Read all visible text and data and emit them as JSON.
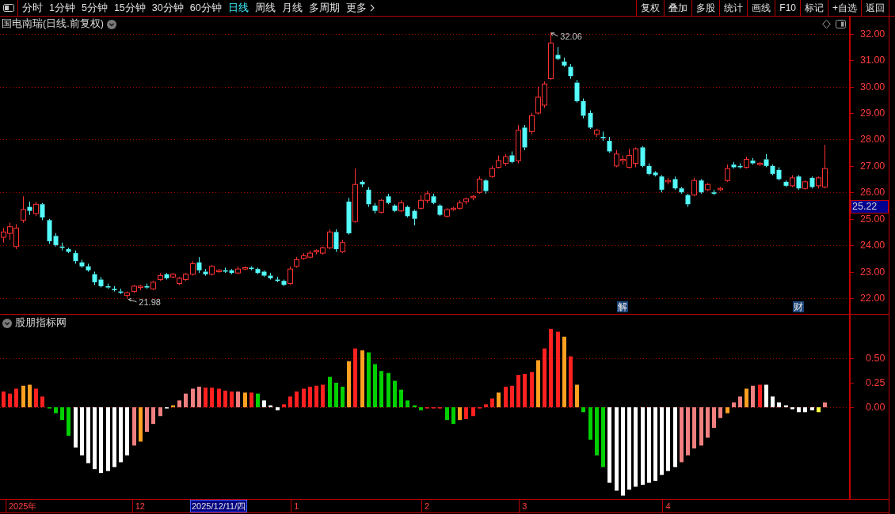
{
  "toolbar": {
    "periods": [
      {
        "label": "分时",
        "selected": false,
        "kind": "period"
      },
      {
        "label": "1分钟",
        "selected": false,
        "kind": "period"
      },
      {
        "label": "5分钟",
        "selected": false,
        "kind": "period"
      },
      {
        "label": "15分钟",
        "selected": false,
        "kind": "period"
      },
      {
        "label": "30分钟",
        "selected": false,
        "kind": "period"
      },
      {
        "label": "60分钟",
        "selected": false,
        "kind": "period"
      },
      {
        "label": "日线",
        "selected": true,
        "kind": "period"
      },
      {
        "label": "周线",
        "selected": false,
        "kind": "period"
      },
      {
        "label": "月线",
        "selected": false,
        "kind": "period"
      },
      {
        "label": "多周期",
        "selected": false,
        "kind": "period"
      },
      {
        "label": "更多",
        "selected": false,
        "kind": "menu"
      }
    ],
    "actions": [
      "复权",
      "叠加",
      "多股",
      "统计",
      "画线",
      "F10",
      "标记",
      "+自选",
      "返回"
    ]
  },
  "price_pane": {
    "title": "国电南瑞(日线.前复权)",
    "cursor_price": "25.22",
    "chart_data": [
      {
        "type": "candlestick",
        "ylim": [
          21.4,
          32.65
        ],
        "grid": true,
        "yticks": [
          {
            "value": 22,
            "label": "22.00"
          },
          {
            "value": 23,
            "label": "23.00"
          },
          {
            "value": 24,
            "label": "24.00"
          },
          {
            "value": 25,
            "label": "25.00"
          },
          {
            "value": 26,
            "label": "26.00"
          },
          {
            "value": 27,
            "label": "27.00"
          },
          {
            "value": 28,
            "label": "28.00"
          },
          {
            "value": 29,
            "label": "29.00"
          },
          {
            "value": 30,
            "label": "30.00"
          },
          {
            "value": 31,
            "label": "31.00"
          },
          {
            "value": 32,
            "label": "32.00"
          }
        ],
        "annotations": [
          "32.06",
          "21.98"
        ],
        "categories": [
          null,
          null,
          null,
          null,
          null,
          null,
          null,
          null,
          null,
          null,
          null,
          null,
          null,
          null,
          null,
          null,
          null,
          null,
          null,
          null,
          null,
          null,
          null,
          null,
          null,
          null,
          null,
          null,
          null,
          null,
          null,
          null,
          null,
          null,
          null,
          null,
          null,
          null,
          null,
          null,
          null,
          null,
          null,
          null,
          null,
          null,
          null,
          null,
          null,
          null,
          null,
          null,
          null,
          null,
          null,
          null,
          null,
          null,
          null,
          null,
          null,
          null,
          null,
          null,
          null,
          null,
          null,
          null,
          null,
          null,
          null,
          null,
          null,
          null,
          null,
          null,
          null,
          null,
          null,
          null,
          null,
          null,
          null,
          null,
          null,
          null,
          null,
          null,
          null,
          null,
          null,
          null,
          null,
          null,
          null,
          "解",
          null,
          null,
          null,
          null,
          null,
          null,
          null,
          null,
          null,
          null,
          null,
          null,
          null,
          null,
          null,
          null,
          null,
          null,
          null,
          null,
          null,
          null,
          null,
          null,
          null,
          null,
          "财",
          null,
          null,
          null,
          null
        ],
        "ohlc": [
          [
            24.3,
            24.65,
            24.1,
            24.5
          ],
          [
            24.45,
            24.85,
            24.2,
            24.7
          ],
          [
            23.95,
            24.8,
            23.85,
            24.65
          ],
          [
            24.95,
            25.85,
            24.85,
            25.35
          ],
          [
            25.45,
            25.65,
            25.15,
            25.3
          ],
          [
            25.2,
            25.65,
            25.1,
            25.55
          ],
          [
            25.55,
            25.6,
            24.95,
            25.05
          ],
          [
            24.95,
            25.0,
            24.05,
            24.15
          ],
          [
            24.35,
            24.45,
            23.95,
            24.0
          ],
          [
            23.95,
            24.1,
            23.8,
            23.9
          ],
          [
            23.85,
            23.9,
            23.7,
            23.75
          ],
          [
            23.7,
            23.8,
            23.3,
            23.4
          ],
          [
            23.35,
            23.45,
            23.15,
            23.2
          ],
          [
            23.2,
            23.3,
            23.0,
            23.05
          ],
          [
            22.9,
            23.0,
            22.5,
            22.6
          ],
          [
            22.7,
            22.8,
            22.4,
            22.45
          ],
          [
            22.45,
            22.55,
            22.35,
            22.4
          ],
          [
            22.35,
            22.45,
            22.25,
            22.3
          ],
          [
            22.25,
            22.35,
            22.15,
            22.2
          ],
          [
            22.1,
            22.25,
            21.98,
            22.2
          ],
          [
            22.25,
            22.5,
            22.2,
            22.45
          ],
          [
            22.4,
            22.5,
            22.3,
            22.45
          ],
          [
            22.45,
            22.55,
            22.35,
            22.4
          ],
          [
            22.35,
            22.65,
            22.3,
            22.6
          ],
          [
            22.7,
            22.95,
            22.65,
            22.85
          ],
          [
            22.9,
            22.95,
            22.7,
            22.75
          ],
          [
            22.8,
            22.95,
            22.75,
            22.9
          ],
          [
            22.55,
            22.8,
            22.5,
            22.75
          ],
          [
            22.7,
            22.95,
            22.65,
            22.9
          ],
          [
            22.9,
            23.4,
            22.85,
            23.3
          ],
          [
            23.35,
            23.55,
            22.95,
            23.05
          ],
          [
            23.0,
            23.1,
            22.85,
            22.9
          ],
          [
            22.9,
            23.25,
            22.85,
            23.2
          ],
          [
            23.0,
            23.1,
            22.95,
            23.05
          ],
          [
            23.05,
            23.15,
            22.95,
            23.0
          ],
          [
            23.05,
            23.1,
            22.9,
            22.95
          ],
          [
            22.95,
            23.2,
            22.9,
            23.1
          ],
          [
            23.1,
            23.2,
            23.05,
            23.15
          ],
          [
            23.15,
            23.2,
            23.05,
            23.1
          ],
          [
            23.1,
            23.15,
            22.9,
            22.95
          ],
          [
            23.0,
            23.05,
            22.8,
            22.85
          ],
          [
            22.85,
            22.95,
            22.7,
            22.75
          ],
          [
            22.7,
            22.8,
            22.6,
            22.65
          ],
          [
            22.65,
            22.7,
            22.45,
            22.5
          ],
          [
            22.55,
            23.2,
            22.5,
            23.1
          ],
          [
            23.2,
            23.55,
            23.15,
            23.45
          ],
          [
            23.5,
            23.7,
            23.45,
            23.6
          ],
          [
            23.55,
            23.8,
            23.5,
            23.7
          ],
          [
            23.75,
            23.85,
            23.65,
            23.8
          ],
          [
            23.7,
            23.95,
            23.65,
            23.9
          ],
          [
            23.9,
            24.6,
            23.85,
            24.5
          ],
          [
            24.5,
            24.6,
            23.75,
            23.85
          ],
          [
            23.75,
            24.2,
            23.7,
            24.1
          ],
          [
            25.65,
            25.8,
            24.4,
            24.45
          ],
          [
            24.9,
            26.9,
            24.85,
            26.3
          ],
          [
            26.4,
            26.45,
            26.2,
            26.3
          ],
          [
            26.1,
            26.2,
            25.45,
            25.55
          ],
          [
            25.5,
            25.6,
            25.2,
            25.3
          ],
          [
            25.25,
            25.75,
            25.2,
            25.7
          ],
          [
            25.85,
            25.95,
            25.55,
            25.6
          ],
          [
            25.5,
            25.55,
            25.25,
            25.3
          ],
          [
            25.3,
            25.7,
            25.25,
            25.6
          ],
          [
            25.45,
            25.5,
            25.05,
            25.1
          ],
          [
            25.3,
            25.35,
            24.75,
            25.0
          ],
          [
            25.4,
            25.9,
            25.35,
            25.7
          ],
          [
            25.7,
            26.05,
            25.6,
            25.95
          ],
          [
            25.85,
            25.95,
            25.55,
            25.6
          ],
          [
            25.5,
            25.55,
            25.1,
            25.15
          ],
          [
            25.1,
            25.4,
            25.05,
            25.35
          ],
          [
            25.35,
            25.45,
            25.3,
            25.4
          ],
          [
            25.4,
            25.7,
            25.35,
            25.6
          ],
          [
            25.65,
            25.8,
            25.55,
            25.75
          ],
          [
            25.8,
            25.9,
            25.7,
            25.85
          ],
          [
            26.0,
            26.6,
            25.95,
            26.5
          ],
          [
            26.45,
            26.5,
            25.95,
            26.05
          ],
          [
            26.6,
            27.0,
            26.55,
            26.9
          ],
          [
            26.95,
            27.4,
            26.9,
            27.2
          ],
          [
            27.1,
            27.45,
            27.0,
            27.35
          ],
          [
            27.4,
            27.55,
            27.1,
            27.15
          ],
          [
            27.2,
            28.55,
            27.1,
            28.35
          ],
          [
            28.45,
            28.55,
            27.6,
            27.7
          ],
          [
            28.3,
            29.0,
            28.2,
            28.9
          ],
          [
            29.0,
            30.0,
            28.95,
            29.6
          ],
          [
            29.3,
            30.2,
            29.2,
            30.1
          ],
          [
            30.3,
            32.06,
            30.25,
            31.65
          ],
          [
            31.2,
            31.5,
            31.0,
            31.05
          ],
          [
            30.95,
            31.1,
            30.75,
            30.8
          ],
          [
            30.75,
            30.85,
            30.3,
            30.4
          ],
          [
            30.15,
            30.25,
            29.4,
            29.45
          ],
          [
            29.45,
            29.55,
            28.8,
            28.9
          ],
          [
            29.0,
            29.1,
            28.4,
            28.45
          ],
          [
            28.2,
            28.4,
            28.1,
            28.35
          ],
          [
            28.1,
            28.3,
            27.95,
            28.05
          ],
          [
            27.95,
            28.1,
            27.5,
            27.55
          ],
          [
            27.0,
            27.6,
            26.95,
            27.45
          ],
          [
            27.2,
            27.4,
            27.05,
            27.25
          ],
          [
            26.95,
            27.65,
            26.9,
            27.4
          ],
          [
            27.1,
            27.7,
            26.95,
            27.65
          ],
          [
            27.7,
            27.75,
            26.95,
            27.0
          ],
          [
            27.0,
            27.1,
            26.65,
            26.7
          ],
          [
            26.75,
            26.8,
            26.6,
            26.65
          ],
          [
            26.6,
            26.65,
            26.0,
            26.1
          ],
          [
            26.4,
            26.55,
            26.3,
            26.45
          ],
          [
            26.5,
            26.6,
            26.1,
            26.15
          ],
          [
            26.15,
            26.2,
            25.95,
            26.0
          ],
          [
            25.9,
            25.95,
            25.45,
            25.55
          ],
          [
            25.9,
            26.55,
            25.85,
            26.45
          ],
          [
            26.45,
            26.5,
            25.95,
            26.0
          ],
          [
            26.1,
            26.35,
            26.05,
            26.3
          ],
          [
            26.0,
            26.1,
            25.9,
            25.95
          ],
          [
            26.1,
            26.2,
            26.05,
            26.15
          ],
          [
            26.45,
            27.05,
            26.4,
            26.9
          ],
          [
            27.05,
            27.15,
            26.9,
            26.95
          ],
          [
            27.0,
            27.1,
            26.9,
            26.95
          ],
          [
            26.95,
            27.35,
            26.9,
            27.25
          ],
          [
            27.2,
            27.3,
            27.05,
            27.1
          ],
          [
            27.05,
            27.15,
            27.0,
            27.1
          ],
          [
            27.25,
            27.45,
            26.95,
            27.0
          ],
          [
            27.0,
            27.05,
            26.65,
            26.7
          ],
          [
            26.85,
            26.95,
            26.45,
            26.5
          ],
          [
            26.4,
            26.45,
            26.2,
            26.25
          ],
          [
            26.25,
            26.65,
            26.2,
            26.55
          ],
          [
            26.6,
            26.65,
            26.1,
            26.15
          ],
          [
            26.15,
            26.45,
            26.1,
            26.4
          ],
          [
            26.55,
            26.6,
            26.15,
            26.2
          ],
          [
            26.25,
            26.6,
            26.15,
            26.55
          ],
          [
            26.2,
            27.8,
            26.15,
            26.9
          ]
        ]
      }
    ]
  },
  "indicator_pane": {
    "title": "股朋指标网",
    "cursor_date": "2025/12/11/四",
    "chart_data": [
      {
        "type": "bar",
        "ylim": [
          -0.935,
          0.944
        ],
        "grid": true,
        "yticks": [
          {
            "value": 0,
            "label": "0.00"
          },
          {
            "value": 0.25,
            "label": "0.25"
          },
          {
            "value": 0.5,
            "label": "0.50"
          }
        ],
        "categories": [
          null,
          null,
          null,
          "2025年",
          null,
          null,
          null,
          null,
          null,
          null,
          null,
          null,
          null,
          null,
          null,
          null,
          null,
          null,
          null,
          null,
          null,
          "12",
          null,
          null,
          null,
          null,
          null,
          null,
          null,
          null,
          null,
          null,
          null,
          null,
          null,
          null,
          null,
          null,
          null,
          null,
          null,
          null,
          null,
          null,
          null,
          "1",
          null,
          null,
          null,
          null,
          null,
          null,
          null,
          null,
          null,
          null,
          null,
          null,
          null,
          null,
          null,
          null,
          null,
          null,
          null,
          "2",
          null,
          null,
          null,
          null,
          null,
          null,
          null,
          null,
          null,
          null,
          null,
          null,
          null,
          null,
          "3",
          null,
          null,
          null,
          null,
          null,
          null,
          null,
          null,
          null,
          null,
          null,
          null,
          null,
          null,
          null,
          null,
          null,
          null,
          null,
          null,
          null,
          "4",
          null,
          null,
          null,
          null,
          null,
          null,
          null,
          null,
          null,
          null,
          null,
          null,
          null,
          null,
          null,
          null,
          null,
          null,
          null,
          null,
          null,
          null,
          null,
          null
        ],
        "values": [
          0.16,
          0.14,
          0.19,
          0.22,
          0.23,
          0.19,
          0.11,
          -0.01,
          -0.06,
          -0.13,
          -0.29,
          -0.41,
          -0.49,
          -0.57,
          -0.63,
          -0.67,
          -0.65,
          -0.61,
          -0.56,
          -0.49,
          -0.39,
          -0.35,
          -0.25,
          -0.17,
          -0.09,
          -0.01,
          0.02,
          0.07,
          0.14,
          0.19,
          0.21,
          0.2,
          0.2,
          0.19,
          0.17,
          0.16,
          0.16,
          0.15,
          0.15,
          0.14,
          0.07,
          0.02,
          -0.03,
          0.03,
          0.11,
          0.16,
          0.19,
          0.21,
          0.22,
          0.23,
          0.31,
          0.25,
          0.21,
          0.47,
          0.6,
          0.58,
          0.56,
          0.44,
          0.37,
          0.35,
          0.27,
          0.18,
          0.07,
          0.02,
          -0.03,
          -0.01,
          -0.01,
          -0.01,
          -0.13,
          -0.17,
          -0.13,
          -0.12,
          -0.09,
          -0.01,
          0.03,
          0.09,
          0.15,
          0.21,
          0.22,
          0.33,
          0.34,
          0.36,
          0.48,
          0.6,
          0.8,
          0.77,
          0.72,
          0.52,
          0.23,
          -0.05,
          -0.33,
          -0.49,
          -0.61,
          -0.77,
          -0.85,
          -0.9,
          -0.84,
          -0.81,
          -0.79,
          -0.77,
          -0.75,
          -0.69,
          -0.65,
          -0.61,
          -0.56,
          -0.49,
          -0.42,
          -0.39,
          -0.31,
          -0.21,
          -0.11,
          -0.06,
          0.05,
          0.11,
          0.19,
          0.22,
          0.23,
          0.23,
          0.11,
          0.05,
          0.02,
          -0.02,
          -0.05,
          -0.05,
          -0.03,
          -0.05,
          0.05
        ],
        "colors": [
          "#ff2020",
          "#ff2020",
          "#ff2020",
          "#ffa020",
          "#ffa020",
          "#ff2020",
          "#ff2020",
          "#00d000",
          "#00d000",
          "#00d000",
          "#00d000",
          "#ffffff",
          "#ffffff",
          "#ffffff",
          "#ffffff",
          "#ffffff",
          "#ffffff",
          "#ffffff",
          "#ffffff",
          "#ffffff",
          "#f08080",
          "#ffa020",
          "#f08080",
          "#f08080",
          "#f08080",
          "#ffffff",
          "#ffa020",
          "#f08080",
          "#f08080",
          "#f08080",
          "#f08080",
          "#ff2020",
          "#ff2020",
          "#ff2020",
          "#ff2020",
          "#ff2020",
          "#f08080",
          "#ffa020",
          "#ff2020",
          "#00d000",
          "#ffffff",
          "#ffffff",
          "#ffffff",
          "#ff2020",
          "#ff2020",
          "#ff2020",
          "#ff2020",
          "#ff2020",
          "#ff2020",
          "#ff2020",
          "#00d000",
          "#00d000",
          "#00d000",
          "#ffa020",
          "#ff2020",
          "#ffa020",
          "#00d000",
          "#00d000",
          "#00d000",
          "#00d000",
          "#00d000",
          "#00d000",
          "#00d000",
          "#00d000",
          "#00d000",
          "#ff2020",
          "#ff2020",
          "#ff2020",
          "#00d000",
          "#00d000",
          "#ffa020",
          "#ff2020",
          "#ff2020",
          "#ff2020",
          "#ff2020",
          "#ff2020",
          "#ffa020",
          "#ff2020",
          "#ff2020",
          "#ff2020",
          "#ff2020",
          "#ff2020",
          "#ffa020",
          "#ff2020",
          "#ff2020",
          "#ff2020",
          "#ffa020",
          "#ff2020",
          "#ffa020",
          "#00d000",
          "#00d000",
          "#00d000",
          "#00d000",
          "#ffffff",
          "#ffffff",
          "#ffffff",
          "#ffffff",
          "#ffffff",
          "#ffffff",
          "#ffffff",
          "#ffffff",
          "#ffffff",
          "#ffffff",
          "#ffffff",
          "#f08080",
          "#f08080",
          "#f08080",
          "#f08080",
          "#f08080",
          "#f08080",
          "#f08080",
          "#ffa020",
          "#f08080",
          "#f08080",
          "#ffa020",
          "#f08080",
          "#ff2020",
          "#ffffff",
          "#ffffff",
          "#ffffff",
          "#ffffff",
          "#ffffff",
          "#ffffff",
          "#ffffff",
          "#ffffff",
          "#ffff40",
          "#f08080"
        ]
      }
    ]
  }
}
